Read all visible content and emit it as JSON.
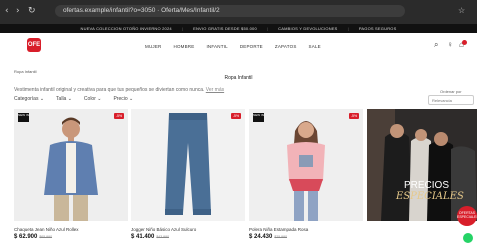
{
  "browser": {
    "back": "‹",
    "forward": "›",
    "reload": "↻",
    "url": "ofertas.example/infantil?o=3050 · Oferta/Mes/Infantil/2",
    "star": "☆"
  },
  "promo": [
    "NUEVA COLECCION OTOÑO INVIERNO 2024",
    "ENVIO GRATIS DESDE $50.000",
    "CAMBIOS Y DEVOLUCIONES",
    "PAGOS SEGUROS"
  ],
  "brand": {
    "logo_text": "OFE"
  },
  "menu": [
    "MUJER",
    "HOMBRE",
    "INFANTIL",
    "DEPORTE",
    "ZAPATOS",
    "SALE"
  ],
  "icons": {
    "search": "⌕",
    "user": "♀",
    "cart": "⌂"
  },
  "breadcrumb": "Ropa Infantil",
  "page_title": "Ropa Infantil",
  "description": "Vestimenta infantil original y creativa para que tus pequeños se diviertan como nunca.",
  "description_link": "Ver más",
  "filters": [
    "Categorías ⌄",
    "Talla ⌄",
    "Color ⌄",
    "Precio ⌄"
  ],
  "sort": {
    "label": "Ordenar por",
    "value": "Relevancia"
  },
  "products": [
    {
      "tag": "NEW IN",
      "discount": "-5%",
      "name": "Chaqueta Jean Niño Azul Rollex",
      "price": "$ 62.900",
      "old_price": "$65.990"
    },
    {
      "tag": "NEW IN",
      "discount": "-5%",
      "name": "Jogger Niño Básico Azul Sulcuro",
      "price": "$ 41.400",
      "old_price": "$43.990"
    },
    {
      "tag": "NEW IN",
      "discount": "-5%",
      "name": "Polera Niña Estampada Rosa",
      "price": "$ 24.430",
      "old_price": "$25.990"
    }
  ],
  "banner": {
    "line1": "PRECIOS",
    "line2": "ESPECIALES"
  },
  "chat_fab": "OFERTAS ESPECIALES"
}
